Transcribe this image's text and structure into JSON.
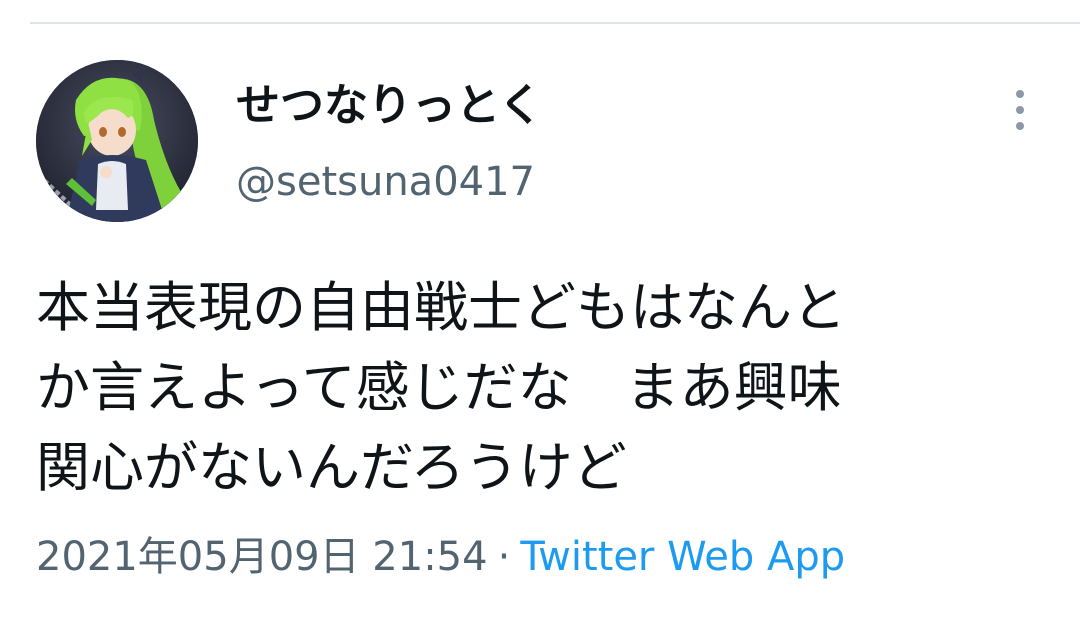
{
  "tweet": {
    "display_name": "せつなりっとく",
    "handle": "@setsuna0417",
    "text_lines": [
      "本当表現の自由戦士どもはなんと",
      "か言えよって感じだな　まあ興味",
      "関心がないんだろうけど"
    ],
    "timestamp": "2021年05月09日 21:54",
    "separator": "·",
    "source": "Twitter Web App"
  },
  "icons": {
    "more": "more-vertical-icon",
    "avatar": "profile-avatar"
  },
  "colors": {
    "text": "#0f1419",
    "secondary": "#536471",
    "link": "#1d9bf0",
    "divider": "#dfe6ea"
  }
}
